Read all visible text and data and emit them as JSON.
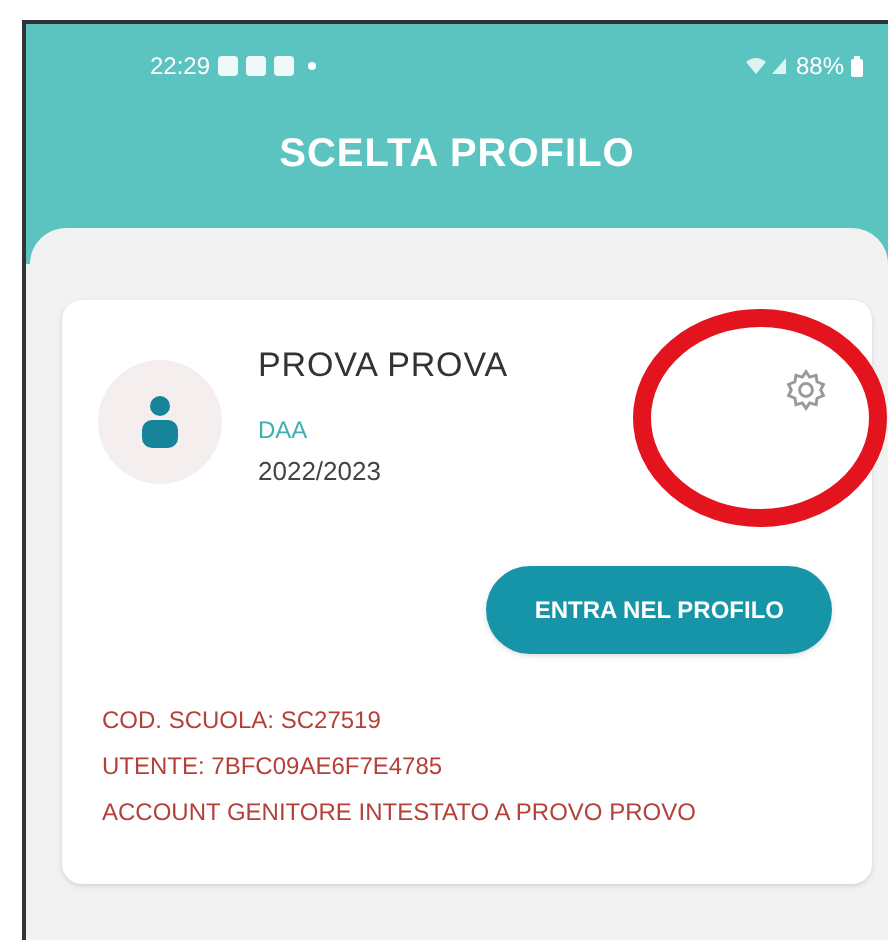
{
  "status_bar": {
    "time": "22:29",
    "battery": "88%"
  },
  "header": {
    "title": "SCELTA PROFILO"
  },
  "profile": {
    "name": "PROVA PROVA",
    "class": "DAA",
    "year": "2022/2023",
    "button": "ENTRA NEL PROFILO",
    "details": [
      "COD. SCUOLA: SC27519",
      "UTENTE: 7BFC09AE6F7E4785",
      "ACCOUNT GENITORE INTESTATO A PROVO PROVO"
    ]
  }
}
